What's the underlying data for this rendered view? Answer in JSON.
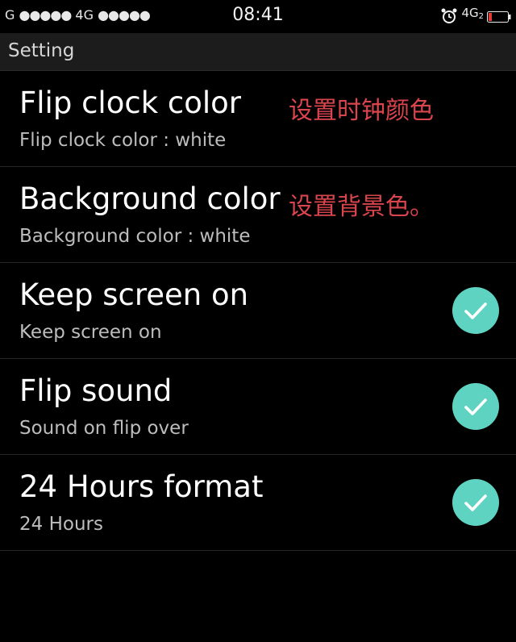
{
  "status_bar": {
    "carrier_left": "G",
    "signal1_dots": "●●●●●",
    "network1": "4G",
    "signal2_dots": "●●●●●",
    "time": "08:41",
    "network2": "4G",
    "network2_sub": "2",
    "icons": [
      "alarm-clock-icon",
      "battery-low-icon"
    ]
  },
  "header": {
    "title": "Setting"
  },
  "settings": [
    {
      "title": "Flip clock color",
      "subtitle": "Flip clock color : white",
      "annotation": "设置时钟颜色",
      "checked": null
    },
    {
      "title": "Background color",
      "subtitle": "Background color : white",
      "annotation": "设置背景色。",
      "checked": null
    },
    {
      "title": "Keep screen on",
      "subtitle": "Keep screen on",
      "checked": true
    },
    {
      "title": "Flip sound",
      "subtitle": "Sound on flip over",
      "checked": true
    },
    {
      "title": "24 Hours format",
      "subtitle": "24 Hours",
      "checked": true
    }
  ],
  "colors": {
    "background": "#000000",
    "header_bg": "#1c1c1c",
    "check_accent": "#5ed3c2",
    "annotation": "#d9454d",
    "battery_low": "#e53935"
  }
}
